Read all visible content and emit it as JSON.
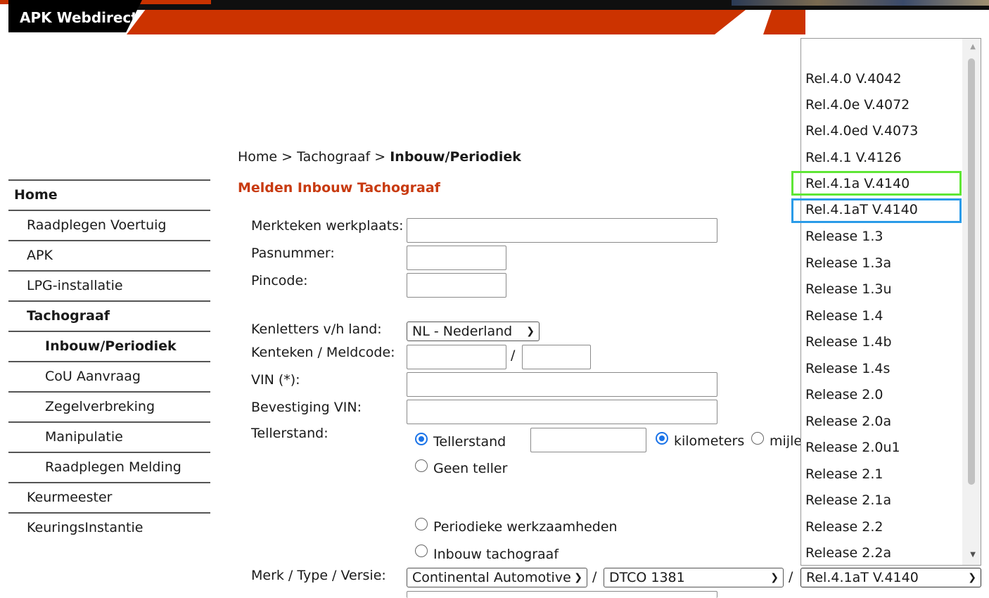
{
  "header": {
    "title": "APK Webdirect"
  },
  "sidebar": {
    "items": [
      {
        "label": "Home"
      },
      {
        "label": "Raadplegen Voertuig"
      },
      {
        "label": "APK"
      },
      {
        "label": "LPG-installatie"
      },
      {
        "label": "Tachograaf"
      },
      {
        "label": "Inbouw/Periodiek"
      },
      {
        "label": "CoU Aanvraag"
      },
      {
        "label": "Zegelverbreking"
      },
      {
        "label": "Manipulatie"
      },
      {
        "label": "Raadplegen Melding"
      },
      {
        "label": "Keurmeester"
      },
      {
        "label": "KeuringsInstantie"
      }
    ]
  },
  "breadcrumb": {
    "home": "Home",
    "sep": ">",
    "section": "Tachograaf",
    "current": "Inbouw/Periodiek"
  },
  "page_title": "Melden Inbouw Tachograaf",
  "form": {
    "merkteken_label": "Merkteken werkplaats:",
    "merkteken_value": "",
    "pasnummer_label": "Pasnummer:",
    "pincode_label": "Pincode:",
    "kenletters_label": "Kenletters v/h land:",
    "kenletters_value": "NL - Nederland",
    "kenteken_label": "Kenteken / Meldcode:",
    "slash": "/",
    "vin_label": "VIN (*):",
    "bevestiging_vin_label": "Bevestiging VIN:",
    "tellerstand_label": "Tellerstand:",
    "radio_tellerstand": "Tellerstand",
    "radio_kilometers": "kilometers",
    "radio_mijlen": "mijle",
    "radio_geen_teller": "Geen teller",
    "radio_periodieke": "Periodieke werkzaamheden",
    "radio_inbouw": "Inbouw tachograaf",
    "merk_type_label": "Merk / Type / Versie:",
    "merk_value": "Continental Automotive",
    "type_value": "DTCO 1381",
    "versie_value": "Rel.4.1aT V.4140"
  },
  "dropdown": {
    "options": [
      "Rel.4.0 V.4042",
      "Rel.4.0e V.4072",
      "Rel.4.0ed V.4073",
      "Rel.4.1 V.4126",
      "Rel.4.1a V.4140",
      "Rel.4.1aT V.4140",
      "Release 1.3",
      "Release 1.3a",
      "Release 1.3u",
      "Release 1.4",
      "Release 1.4b",
      "Release 1.4s",
      "Release 2.0",
      "Release 2.0a",
      "Release 2.0u1",
      "Release 2.1",
      "Release 2.1a",
      "Release 2.2",
      "Release 2.2a"
    ]
  },
  "colors": {
    "accent_red": "#cc3300",
    "title_red": "#c83a10",
    "highlight_green": "#5fe636",
    "highlight_blue": "#2a9be8"
  }
}
